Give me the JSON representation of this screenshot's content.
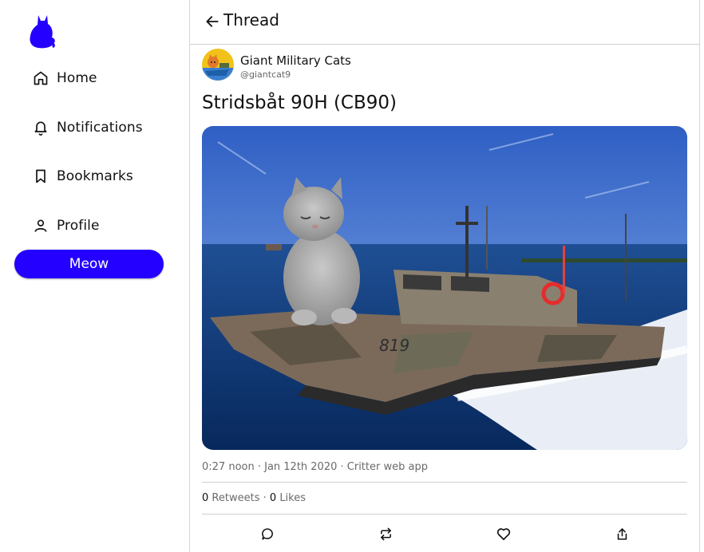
{
  "sidebar": {
    "logo_icon": "cat-logo-icon",
    "items": [
      {
        "label": "Home",
        "icon": "home-icon"
      },
      {
        "label": "Notifications",
        "icon": "bell-icon"
      },
      {
        "label": "Bookmarks",
        "icon": "bookmark-icon"
      },
      {
        "label": "Profile",
        "icon": "user-icon"
      }
    ],
    "meow_label": "Meow"
  },
  "header": {
    "back_icon": "arrow-left-icon",
    "title": "Thread"
  },
  "post": {
    "author_name": "Giant Military Cats",
    "author_handle": "@giantcat9",
    "title": "Stridsbåt 90H (CB90)",
    "image_alt": "cat on military boat",
    "meta": "0:27 noon · Jan 12th 2020 · Critter web app",
    "retweets_count": "0",
    "retweets_label": "Retweets",
    "separator": "·",
    "likes_count": "0",
    "likes_label": "Likes",
    "actions": [
      "reply-icon",
      "retweet-icon",
      "heart-icon",
      "share-icon"
    ]
  },
  "colors": {
    "accent": "#2300ff",
    "divider": "#cfcfcf",
    "muted_text": "#6a6a6a"
  }
}
